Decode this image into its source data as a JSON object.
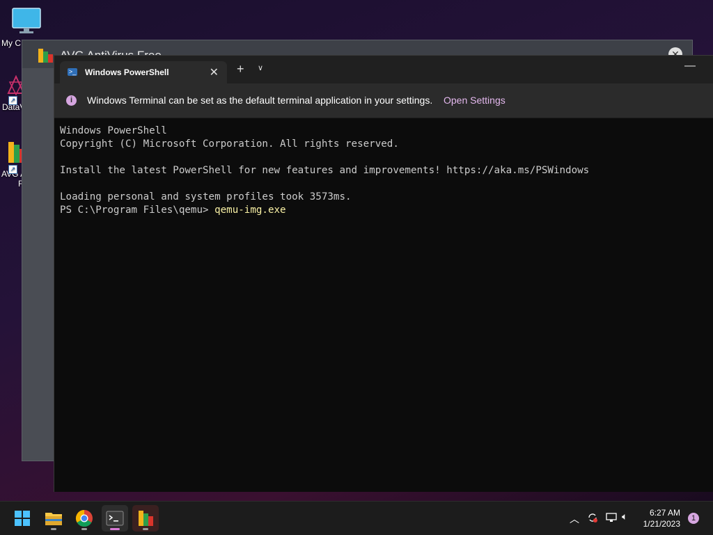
{
  "desktop": {
    "icons": [
      {
        "label": "My C",
        "icon": "computer-icon"
      },
      {
        "label": "DataV",
        "icon": "datav-icon"
      },
      {
        "label": "AVG A",
        "label2": "F",
        "icon": "avg-icon"
      }
    ]
  },
  "avg_window": {
    "title": "AVG AntiVirus Free"
  },
  "terminal": {
    "tab_title": "Windows PowerShell",
    "infobar": {
      "message": "Windows Terminal can be set as the default terminal application in your settings.",
      "link": "Open Settings"
    },
    "lines": [
      "Windows PowerShell",
      "Copyright (C) Microsoft Corporation. All rights reserved.",
      "",
      "Install the latest PowerShell for new features and improvements! https://aka.ms/PSWindows",
      "",
      "Loading personal and system profiles took 3573ms."
    ],
    "prompt": "PS C:\\Program Files\\qemu> ",
    "command": "qemu-img.exe"
  },
  "taskbar": {
    "apps": [
      "start-icon",
      "file-explorer-icon",
      "chrome-icon",
      "terminal-icon",
      "avg-icon"
    ],
    "time": "6:27 AM",
    "date": "1/21/2023",
    "notification_count": "1"
  },
  "colors": {
    "accent": "#d6a6e0",
    "console_bg": "#0c0c0c",
    "command_text": "#f9f1a5"
  }
}
